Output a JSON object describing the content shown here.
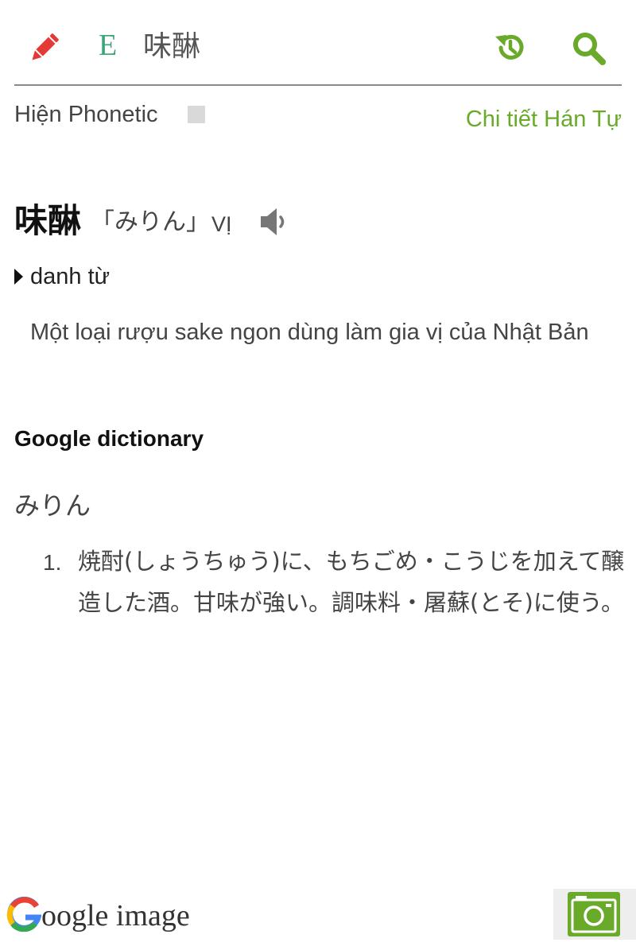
{
  "header": {
    "edit_icon": "pencil-icon",
    "language_badge": "E",
    "search_term": "味醂",
    "history_icon": "history-icon",
    "search_icon": "search-icon",
    "accent_color": "#6aaa2a"
  },
  "phonetic_row": {
    "toggle_label": "Hiện Phonetic",
    "kanji_detail_link": "Chi tiết Hán Tự"
  },
  "entry": {
    "kanji": "味醂",
    "reading": "「みりん」",
    "hanviet": "VỊ",
    "speaker_icon": "speaker-icon",
    "part_of_speech": "danh từ",
    "meaning": "Một loại rượu sake ngon dùng làm gia vị của Nhật Bản"
  },
  "google_dictionary": {
    "heading": "Google dictionary",
    "word": "みりん",
    "definitions": [
      {
        "number": "1.",
        "text": "焼酎(しょうちゅう)に、もちごめ・こうじを加えて醸造した酒。甘味が強い。調味料・屠蘇(とそ)に使う。"
      }
    ]
  },
  "footer": {
    "google_image_label": "oogle image",
    "camera_icon": "camera-icon"
  }
}
